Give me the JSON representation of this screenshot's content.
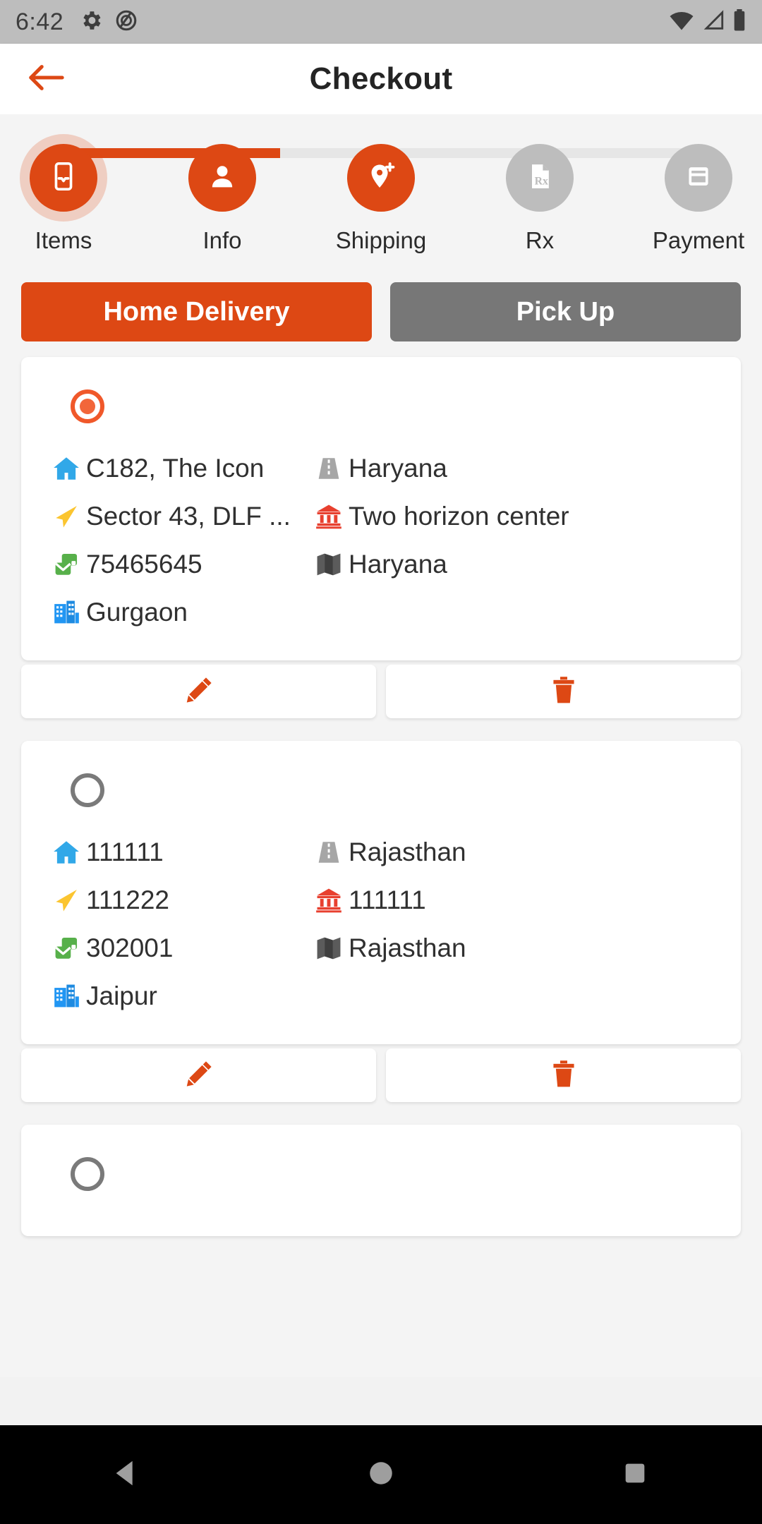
{
  "status_bar": {
    "time": "6:42",
    "left_icons": [
      "gear-icon",
      "no-entry-circle-icon"
    ],
    "right_icons": [
      "wifi-icon",
      "cellular-signal-icon",
      "battery-icon"
    ]
  },
  "app_bar": {
    "back_icon": "back-arrow-icon",
    "title": "Checkout"
  },
  "stepper": {
    "steps": [
      {
        "label": "Items",
        "icon": "mobile-inbox-icon",
        "state": "current"
      },
      {
        "label": "Info",
        "icon": "person-icon",
        "state": "done"
      },
      {
        "label": "Shipping",
        "icon": "location-plus-icon",
        "state": "done"
      },
      {
        "label": "Rx",
        "icon": "prescription-icon",
        "state": "pending"
      },
      {
        "label": "Payment",
        "icon": "card-icon",
        "state": "pending"
      }
    ]
  },
  "delivery_toggle": {
    "options": [
      {
        "label": "Home Delivery",
        "selected": true
      },
      {
        "label": "Pick Up",
        "selected": false
      }
    ]
  },
  "addresses": [
    {
      "selected": true,
      "left": [
        {
          "icon": "house-icon",
          "text": "C182, The Icon"
        },
        {
          "icon": "arrow-icon",
          "text": "Sector 43, DLF ..."
        },
        {
          "icon": "mailbox-icon",
          "text": "75465645"
        },
        {
          "icon": "buildings-icon",
          "text": "Gurgaon"
        }
      ],
      "right": [
        {
          "icon": "road-icon",
          "text": "Haryana"
        },
        {
          "icon": "bank-icon",
          "text": "Two horizon center"
        },
        {
          "icon": "map-icon",
          "text": "Haryana"
        }
      ],
      "actions": [
        {
          "icon": "edit-pencil-icon"
        },
        {
          "icon": "delete-trash-icon"
        }
      ]
    },
    {
      "selected": false,
      "left": [
        {
          "icon": "house-icon",
          "text": "111111"
        },
        {
          "icon": "arrow-icon",
          "text": "111222"
        },
        {
          "icon": "mailbox-icon",
          "text": "302001"
        },
        {
          "icon": "buildings-icon",
          "text": "Jaipur"
        }
      ],
      "right": [
        {
          "icon": "road-icon",
          "text": "Rajasthan"
        },
        {
          "icon": "bank-icon",
          "text": "111111"
        },
        {
          "icon": "map-icon",
          "text": "Rajasthan"
        }
      ],
      "actions": [
        {
          "icon": "edit-pencil-icon"
        },
        {
          "icon": "delete-trash-icon"
        }
      ]
    },
    {
      "selected": false,
      "partial": true,
      "left": [],
      "right": [],
      "actions": []
    }
  ],
  "nav_bar": {
    "buttons": [
      "back-triangle-icon",
      "home-circle-icon",
      "recents-square-icon"
    ]
  },
  "colors": {
    "accent": "#dd4814",
    "accent_light": "#f0582a",
    "inactive": "#bdbdbd",
    "idle_button": "#777777",
    "page_bg": "#f4f4f4",
    "card_bg": "#ffffff",
    "text": "#303030"
  }
}
